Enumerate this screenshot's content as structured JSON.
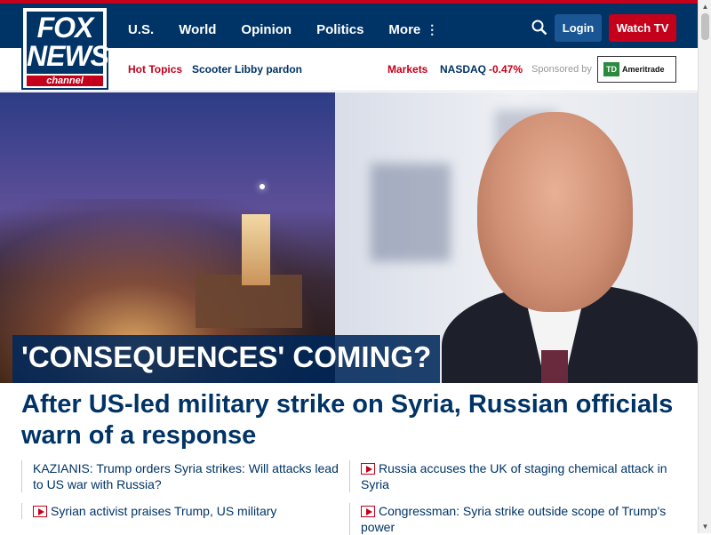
{
  "brand": {
    "logo_top": "FOX",
    "logo_bottom": "NEWS",
    "logo_channel": "channel"
  },
  "nav": {
    "items": [
      "U.S.",
      "World",
      "Opinion",
      "Politics",
      "More"
    ],
    "login": "Login",
    "watch_tv": "Watch TV"
  },
  "subbar": {
    "hot_topics_label": "Hot Topics",
    "hot_topic_1": "Scooter Libby pardon",
    "markets_label": "Markets",
    "nasdaq_label": "NASDAQ",
    "nasdaq_change": "-0.47%",
    "sponsored_by": "Sponsored by",
    "sponsor_logo_mark": "TD",
    "sponsor_name": "Ameritrade"
  },
  "hero": {
    "kicker": "'CONSEQUENCES' COMING?"
  },
  "headline": "After US-led military strike on Syria, Russian officials warn of a response",
  "related": [
    {
      "text": "KAZIANIS: Trump orders Syria strikes: Will attacks lead to US war with Russia?",
      "video": false
    },
    {
      "text": "Russia accuses the UK of staging chemical attack in Syria",
      "video": true
    },
    {
      "text": "Syrian activist praises Trump, US military",
      "video": true
    },
    {
      "text": "Congressman: Syria strike outside scope of Trump's power",
      "video": true
    }
  ],
  "colors": {
    "navy": "#003366",
    "red": "#c5001a",
    "login_blue": "#1a5693"
  },
  "icons": [
    "search-icon",
    "more-dots-icon",
    "play-icon"
  ]
}
